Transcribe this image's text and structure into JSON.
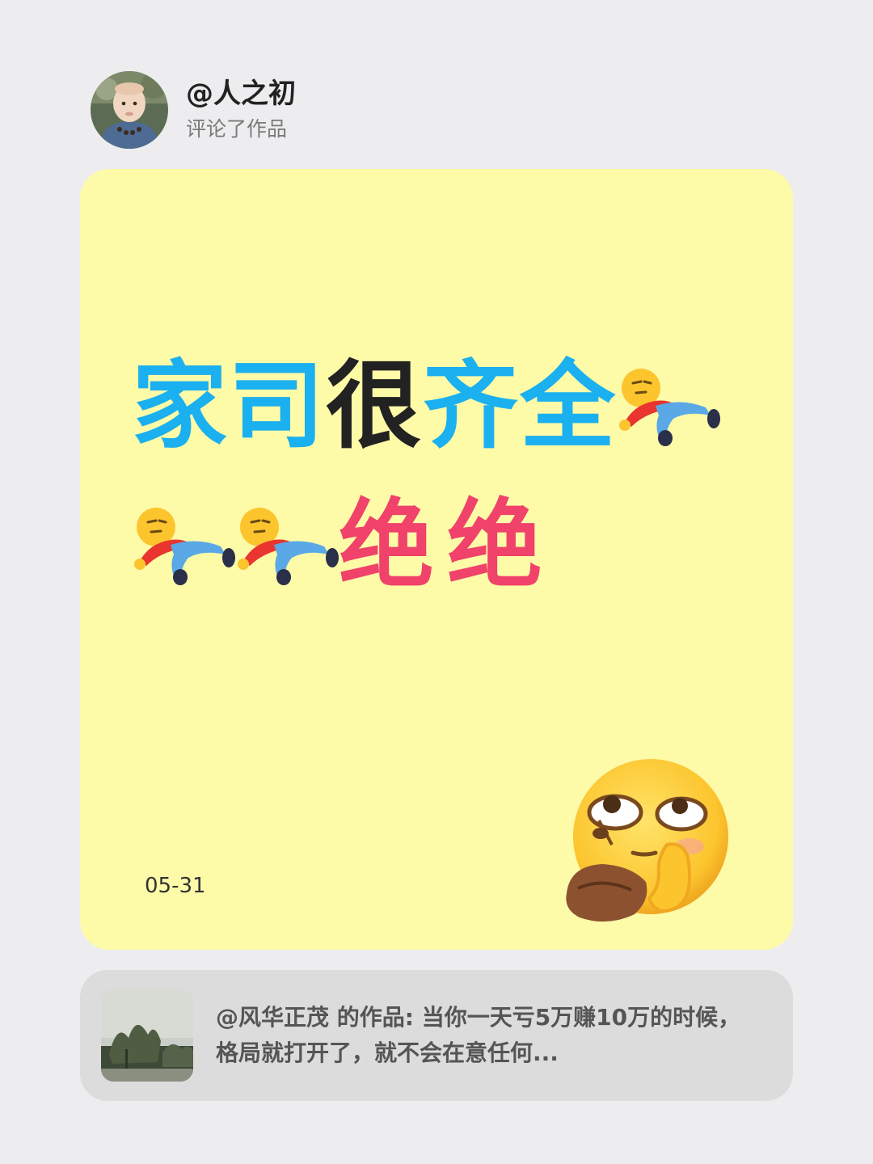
{
  "header": {
    "username": "@人之初",
    "action": "评论了作品"
  },
  "card": {
    "background": "#fdfaa8",
    "line1": {
      "part1": "家司",
      "part2": "很",
      "part3": "齐全"
    },
    "line2": {
      "part1": "绝",
      "part2": "绝"
    },
    "date": "05-31",
    "colors": {
      "blue": "#1bb0ef",
      "black": "#222222",
      "pink": "#f0426b"
    },
    "emoji": {
      "inline": "lying-down-emoji",
      "sticker": "eye-roll-sunflower-seed-emoji"
    }
  },
  "reference": {
    "text": "@风华正茂  的作品: 当你一天亏5万赚10万的时候，格局就打开了，就不会在意任何..."
  }
}
